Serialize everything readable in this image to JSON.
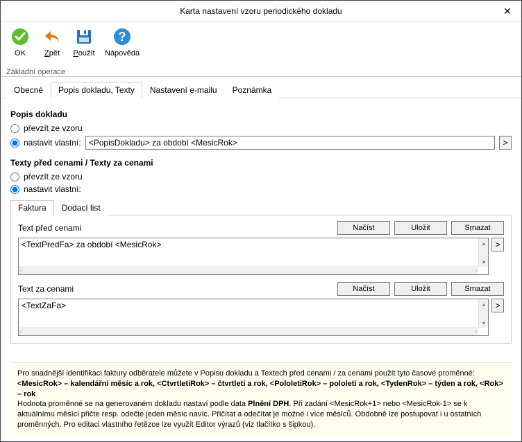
{
  "title": "Karta nastavení vzoru periodického dokladu",
  "ribbon": {
    "buttons": {
      "ok": "OK",
      "back": "Zpět",
      "apply": "Použít",
      "help": "Nápověda"
    },
    "group": "Základní operace"
  },
  "main_tabs": {
    "general": "Obecné",
    "popis": "Popis dokladu, Texty",
    "email": "Nastavení e-mailu",
    "note": "Poznámka"
  },
  "popis": {
    "title": "Popis dokladu",
    "radio_from_template": "převzít ze vzoru",
    "radio_custom": "nastavit vlastní:",
    "input_value": "<PopisDokladu> za období <MesicRok>",
    "expr_btn": ">"
  },
  "texty": {
    "title": "Texty před cenami / Texty za cenami",
    "radio_from_template": "převzít ze vzoru",
    "radio_custom": "nastavit vlastní:",
    "sub_tabs": {
      "faktura": "Faktura",
      "dodaci": "Dodací list"
    },
    "before": {
      "label": "Text před cenami",
      "value": "<TextPredFa> za období <MesicRok>",
      "btn_load": "Načíst",
      "btn_save": "Uložit",
      "btn_delete": "Smazat",
      "expr_btn": ">"
    },
    "after": {
      "label": "Text za cenami",
      "value": "<TextZaFa>",
      "btn_load": "Načíst",
      "btn_save": "Uložit",
      "btn_delete": "Smazat",
      "expr_btn": ">"
    }
  },
  "help": {
    "line1_pre": "Pro snadnější identifikaci faktury odběratele můžete v Popisu dokladu a Textech před cenami / za cenami použít tyto časové proměnné:",
    "line2": "<MesicRok> – kalendářní měsíc a rok, <CtvrtletiRok> – čtvrtletí a rok, <PololetiRok> – pololetí a rok, <TydenRok> – týden a rok, <Rok> – rok",
    "line3_a": "Hodnota proměnné se na generovaném dokladu nastaví podle data ",
    "line3_b": "Plnění DPH",
    "line3_c": ". Při zadání <MesicRok+1> nebo <MesicRok-1> se k aktuálnímu měsíci přičte resp. odečte jeden měsíc navíc. Přičítat a odečítat je možné i více měsíců. Obdobně lze postupovat i u ostatních proměnných. Pro editaci vlastního řetězce lze využít Editor výrazů (viz tlačítko s šipkou)."
  },
  "icons": {
    "check": "green-check",
    "back": "orange-undo",
    "save": "blue-disk",
    "help": "blue-question"
  }
}
